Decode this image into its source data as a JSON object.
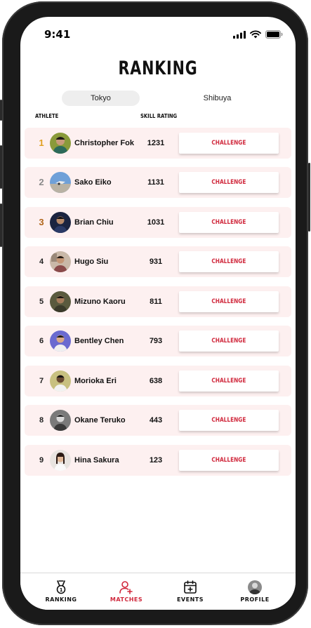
{
  "status_bar": {
    "time": "9:41"
  },
  "page_title": "RANKING",
  "location_tabs": [
    {
      "label": "Tokyo",
      "active": true
    },
    {
      "label": "Shibuya",
      "active": false
    }
  ],
  "columns": {
    "athlete": "ATHLETE",
    "skill_rating": "SKILL RATING"
  },
  "rows": [
    {
      "rank": "1",
      "name": "Christopher Fok",
      "rating": "1231",
      "action": "CHALLENGE"
    },
    {
      "rank": "2",
      "name": "Sako Eiko",
      "rating": "1131",
      "action": "CHALLENGE"
    },
    {
      "rank": "3",
      "name": "Brian Chiu",
      "rating": "1031",
      "action": "CHALLENGE"
    },
    {
      "rank": "4",
      "name": "Hugo Siu",
      "rating": "931",
      "action": "CHALLENGE"
    },
    {
      "rank": "5",
      "name": "Mizuno Kaoru",
      "rating": "811",
      "action": "CHALLENGE"
    },
    {
      "rank": "6",
      "name": "Bentley Chen",
      "rating": "793",
      "action": "CHALLENGE"
    },
    {
      "rank": "7",
      "name": "Morioka Eri",
      "rating": "638",
      "action": "CHALLENGE"
    },
    {
      "rank": "8",
      "name": "Okane Teruko",
      "rating": "443",
      "action": "CHALLENGE"
    },
    {
      "rank": "9",
      "name": "Hina Sakura",
      "rating": "123",
      "action": "CHALLENGE"
    }
  ],
  "tab_bar": [
    {
      "label": "RANKING",
      "icon": "medal-icon",
      "active": false
    },
    {
      "label": "MATCHES",
      "icon": "add-user-icon",
      "active": true
    },
    {
      "label": "EVENTS",
      "icon": "calendar-plus-icon",
      "active": false
    },
    {
      "label": "PROFILE",
      "icon": "avatar",
      "active": false
    }
  ],
  "colors": {
    "accent": "#d0283c",
    "gold": "#e0a020",
    "silver": "#8a8a8a",
    "bronze": "#b0651a",
    "row_background": "#fdf0f0"
  }
}
